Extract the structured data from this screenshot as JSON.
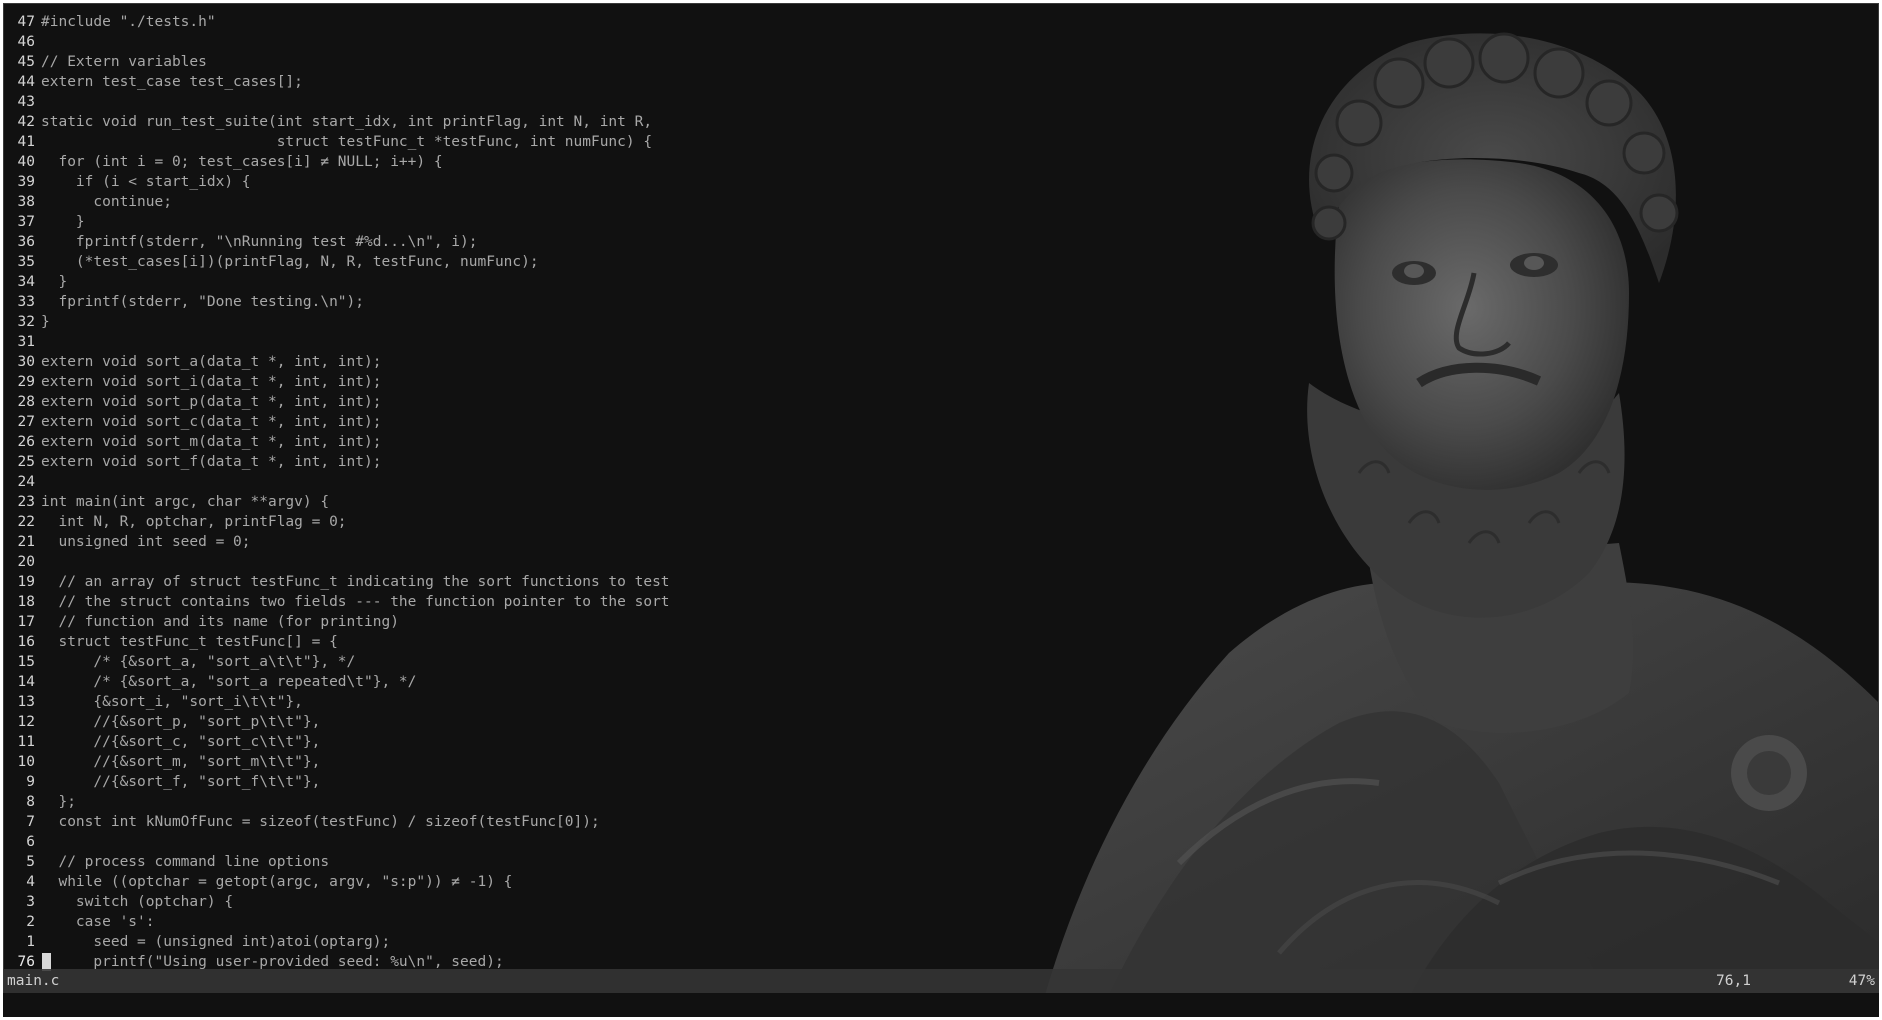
{
  "editor": {
    "lines": [
      {
        "n": "47",
        "code": "#include \"./tests.h\""
      },
      {
        "n": "46",
        "code": ""
      },
      {
        "n": "45",
        "code": "// Extern variables"
      },
      {
        "n": "44",
        "code": "extern test_case test_cases[];"
      },
      {
        "n": "43",
        "code": ""
      },
      {
        "n": "42",
        "code": "static void run_test_suite(int start_idx, int printFlag, int N, int R,"
      },
      {
        "n": "41",
        "code": "                           struct testFunc_t *testFunc, int numFunc) {"
      },
      {
        "n": "40",
        "code": "  for (int i = 0; test_cases[i] ≠ NULL; i++) {"
      },
      {
        "n": "39",
        "code": "    if (i < start_idx) {"
      },
      {
        "n": "38",
        "code": "      continue;"
      },
      {
        "n": "37",
        "code": "    }"
      },
      {
        "n": "36",
        "code": "    fprintf(stderr, \"\\nRunning test #%d...\\n\", i);"
      },
      {
        "n": "35",
        "code": "    (*test_cases[i])(printFlag, N, R, testFunc, numFunc);"
      },
      {
        "n": "34",
        "code": "  }"
      },
      {
        "n": "33",
        "code": "  fprintf(stderr, \"Done testing.\\n\");"
      },
      {
        "n": "32",
        "code": "}"
      },
      {
        "n": "31",
        "code": ""
      },
      {
        "n": "30",
        "code": "extern void sort_a(data_t *, int, int);"
      },
      {
        "n": "29",
        "code": "extern void sort_i(data_t *, int, int);"
      },
      {
        "n": "28",
        "code": "extern void sort_p(data_t *, int, int);"
      },
      {
        "n": "27",
        "code": "extern void sort_c(data_t *, int, int);"
      },
      {
        "n": "26",
        "code": "extern void sort_m(data_t *, int, int);"
      },
      {
        "n": "25",
        "code": "extern void sort_f(data_t *, int, int);"
      },
      {
        "n": "24",
        "code": ""
      },
      {
        "n": "23",
        "code": "int main(int argc, char **argv) {"
      },
      {
        "n": "22",
        "code": "  int N, R, optchar, printFlag = 0;"
      },
      {
        "n": "21",
        "code": "  unsigned int seed = 0;"
      },
      {
        "n": "20",
        "code": ""
      },
      {
        "n": "19",
        "code": "  // an array of struct testFunc_t indicating the sort functions to test"
      },
      {
        "n": "18",
        "code": "  // the struct contains two fields --- the function pointer to the sort"
      },
      {
        "n": "17",
        "code": "  // function and its name (for printing)"
      },
      {
        "n": "16",
        "code": "  struct testFunc_t testFunc[] = {"
      },
      {
        "n": "15",
        "code": "      /* {&sort_a, \"sort_a\\t\\t\"}, */"
      },
      {
        "n": "14",
        "code": "      /* {&sort_a, \"sort_a repeated\\t\"}, */"
      },
      {
        "n": "13",
        "code": "      {&sort_i, \"sort_i\\t\\t\"},"
      },
      {
        "n": "12",
        "code": "      //{&sort_p, \"sort_p\\t\\t\"},"
      },
      {
        "n": "11",
        "code": "      //{&sort_c, \"sort_c\\t\\t\"},"
      },
      {
        "n": "10",
        "code": "      //{&sort_m, \"sort_m\\t\\t\"},"
      },
      {
        "n": "9",
        "code": "      //{&sort_f, \"sort_f\\t\\t\"},"
      },
      {
        "n": "8",
        "code": "  };"
      },
      {
        "n": "7",
        "code": "  const int kNumOfFunc = sizeof(testFunc) / sizeof(testFunc[0]);"
      },
      {
        "n": "6",
        "code": ""
      },
      {
        "n": "5",
        "code": "  // process command line options"
      },
      {
        "n": "4",
        "code": "  while ((optchar = getopt(argc, argv, \"s:p\")) ≠ -1) {"
      },
      {
        "n": "3",
        "code": "    switch (optchar) {"
      },
      {
        "n": "2",
        "code": "    case 's':"
      },
      {
        "n": "1",
        "code": "      seed = (unsigned int)atoi(optarg);"
      },
      {
        "n": "76",
        "code": "      printf(\"Using user-provided seed: %u\\n\", seed);"
      }
    ]
  },
  "statusbar": {
    "filename": "main.c",
    "position": "76,1",
    "percent": "47%"
  },
  "theme": {
    "background": "#111111",
    "text": "#a8a8a8",
    "line_number": "#d4d4d4",
    "statusbar_bg": "#343434",
    "cursor": "#d8d8d8"
  },
  "background_image": "marble-bust-image"
}
